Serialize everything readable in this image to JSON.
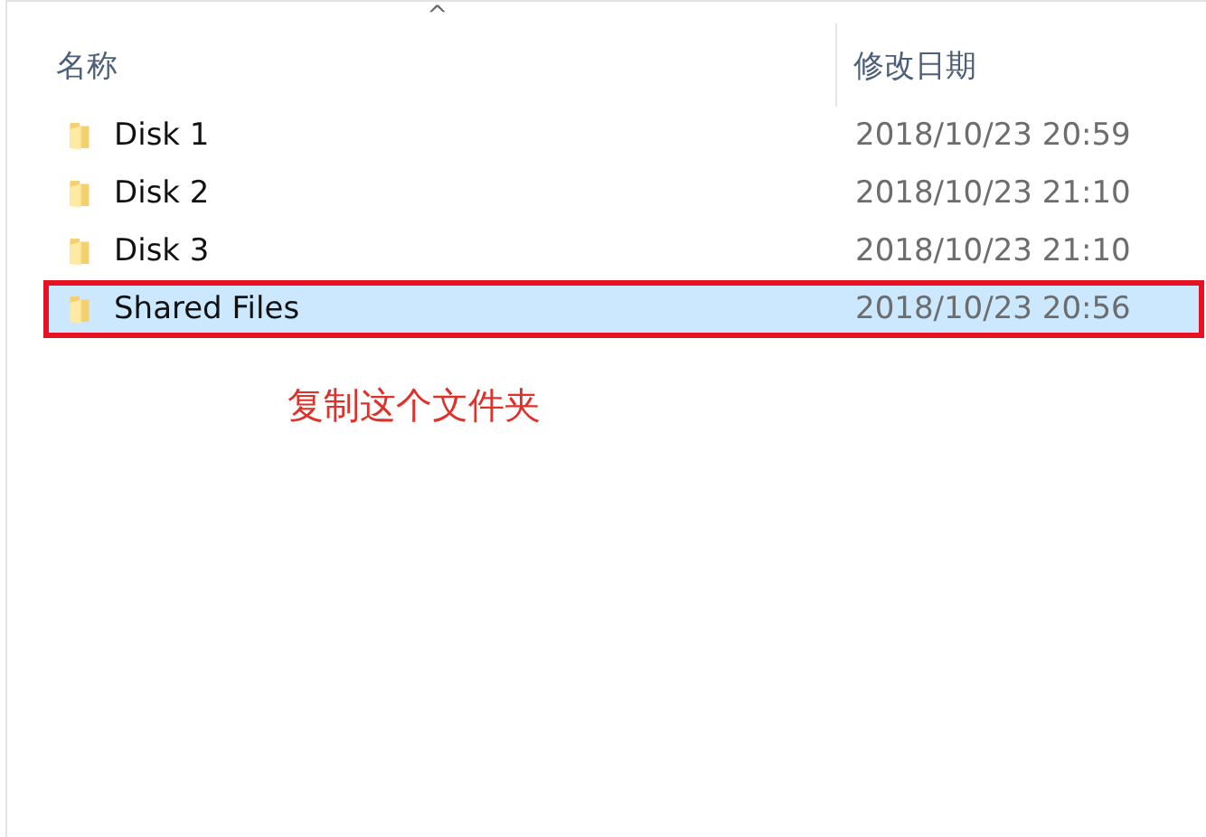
{
  "columns": [
    {
      "label": "名称",
      "sort_caret": "^"
    },
    {
      "label": "修改日期"
    }
  ],
  "rows": [
    {
      "name": "Disk 1",
      "modified": "2018/10/23 20:59",
      "selected": false
    },
    {
      "name": "Disk 2",
      "modified": "2018/10/23 21:10",
      "selected": false
    },
    {
      "name": "Disk 3",
      "modified": "2018/10/23 21:10",
      "selected": false
    },
    {
      "name": "Shared Files",
      "modified": "2018/10/23 20:56",
      "selected": true
    }
  ],
  "annotation": "复制这个文件夹"
}
